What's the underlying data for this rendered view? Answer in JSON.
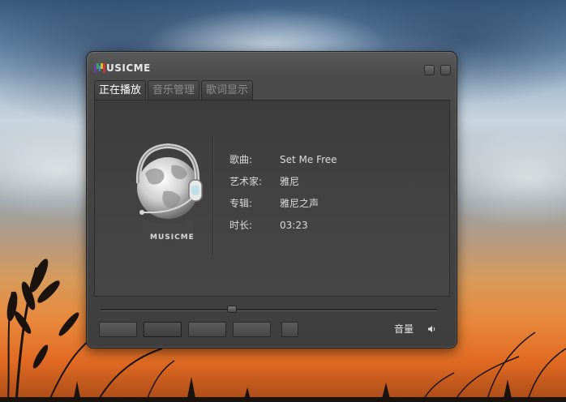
{
  "app": {
    "logo_text": "USICME",
    "album_brand": "MUSICME"
  },
  "tabs": [
    {
      "label": "正在播放",
      "active": true
    },
    {
      "label": "音乐管理",
      "active": false
    },
    {
      "label": "歌词显示",
      "active": false
    }
  ],
  "track": {
    "fields": [
      {
        "label": "歌曲:",
        "value": "Set Me Free"
      },
      {
        "label": "艺术家:",
        "value": "雅尼"
      },
      {
        "label": "专辑:",
        "value": "雅尼之声"
      },
      {
        "label": "时长:",
        "value": "03:23"
      }
    ]
  },
  "seek": {
    "progress": 0.39
  },
  "volume": {
    "label": "音量",
    "icon": "speaker-icon"
  },
  "colors": {
    "window_bg": "#434343",
    "text": "#dcdcdc",
    "active_tab_text": "#ffffff",
    "inactive_tab_text": "#8d8d8d"
  }
}
